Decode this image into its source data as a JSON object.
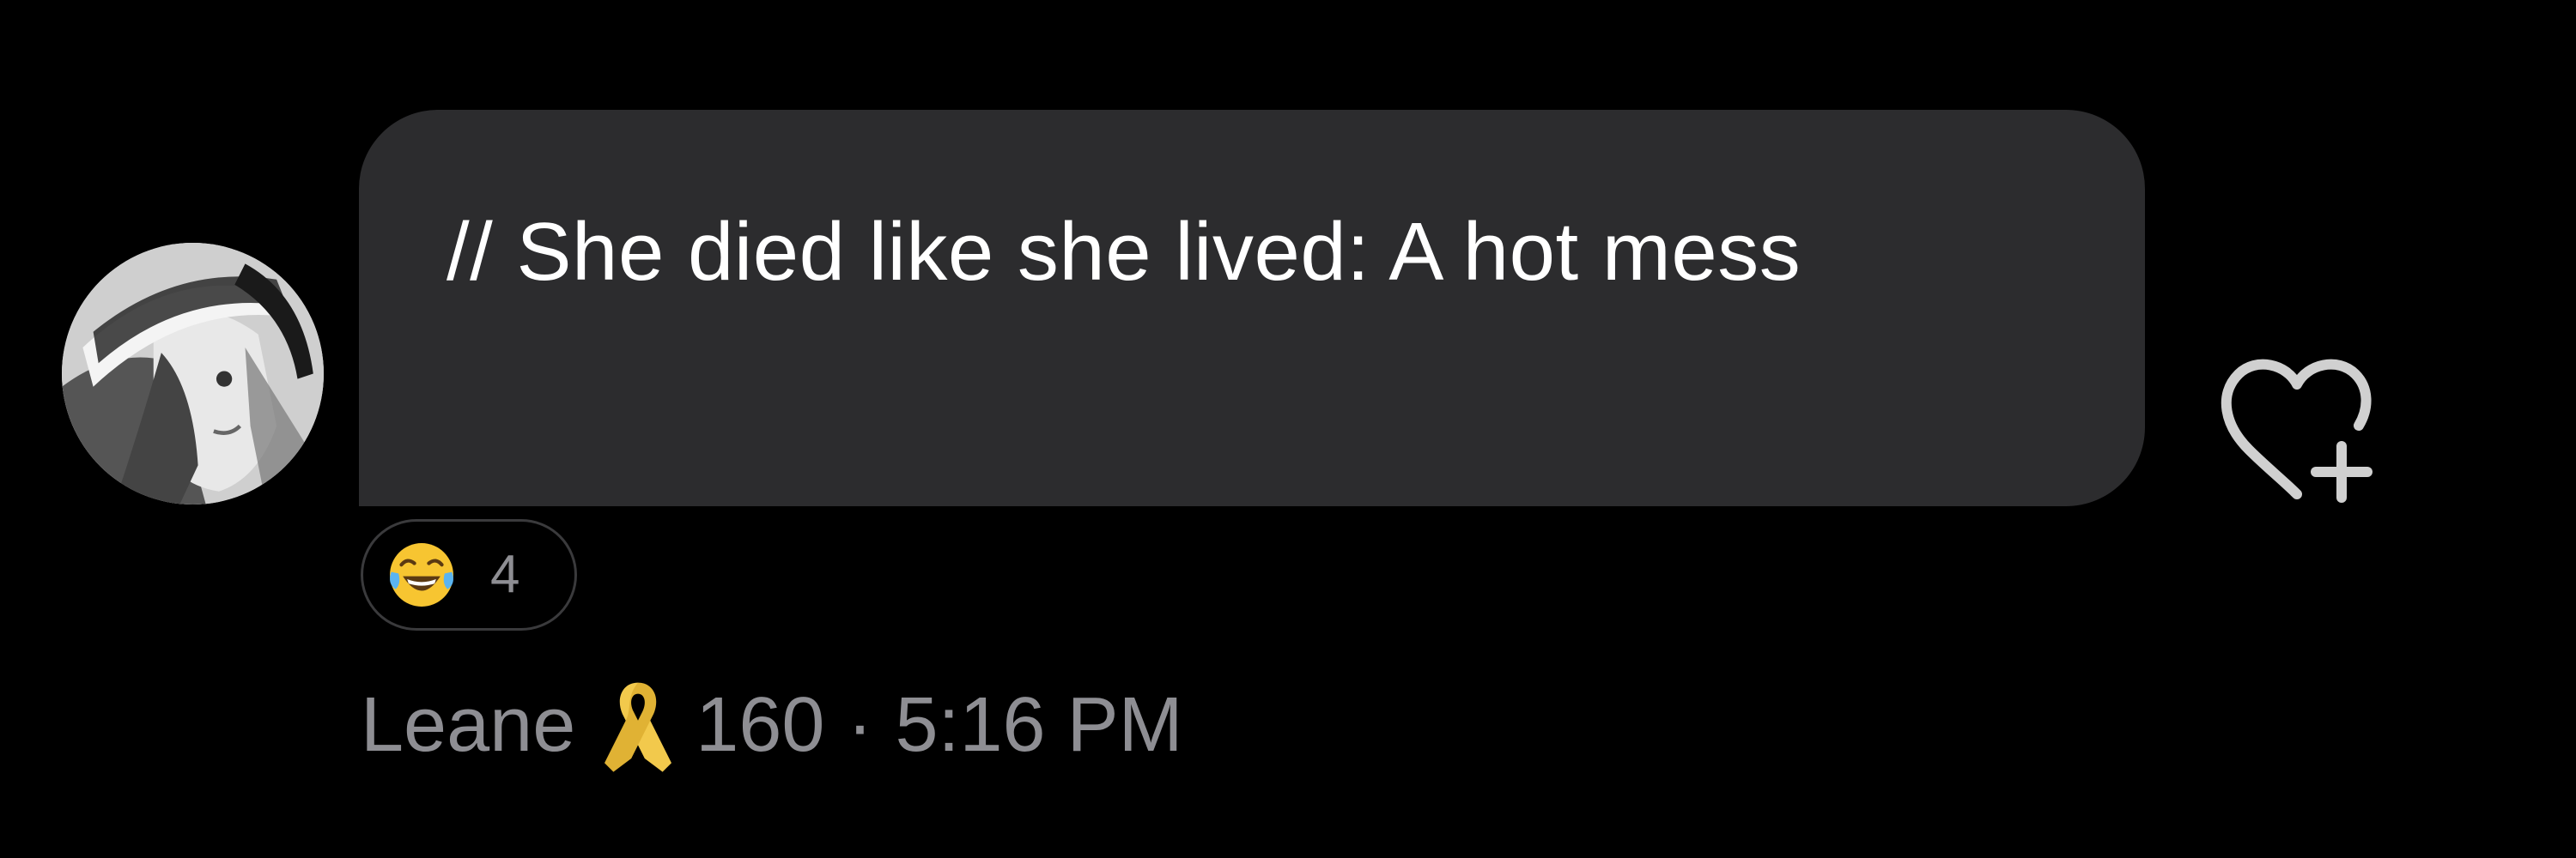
{
  "message": {
    "text": "// She died like she lived: A hot mess",
    "author": {
      "name": "Leane",
      "badge_icon": "yellow-ribbon-icon",
      "badge_color": "#f2c94c",
      "score": "160"
    },
    "separator": "·",
    "time": "5:16 PM",
    "reactions": [
      {
        "icon": "face-with-tears-of-joy-icon",
        "count": "4"
      }
    ]
  },
  "controls": {
    "add_reaction_icon": "heart-plus-icon"
  },
  "colors": {
    "background": "#000000",
    "bubble": "#2c2c2e",
    "text": "#ffffff",
    "meta_text": "#8e8e93"
  }
}
